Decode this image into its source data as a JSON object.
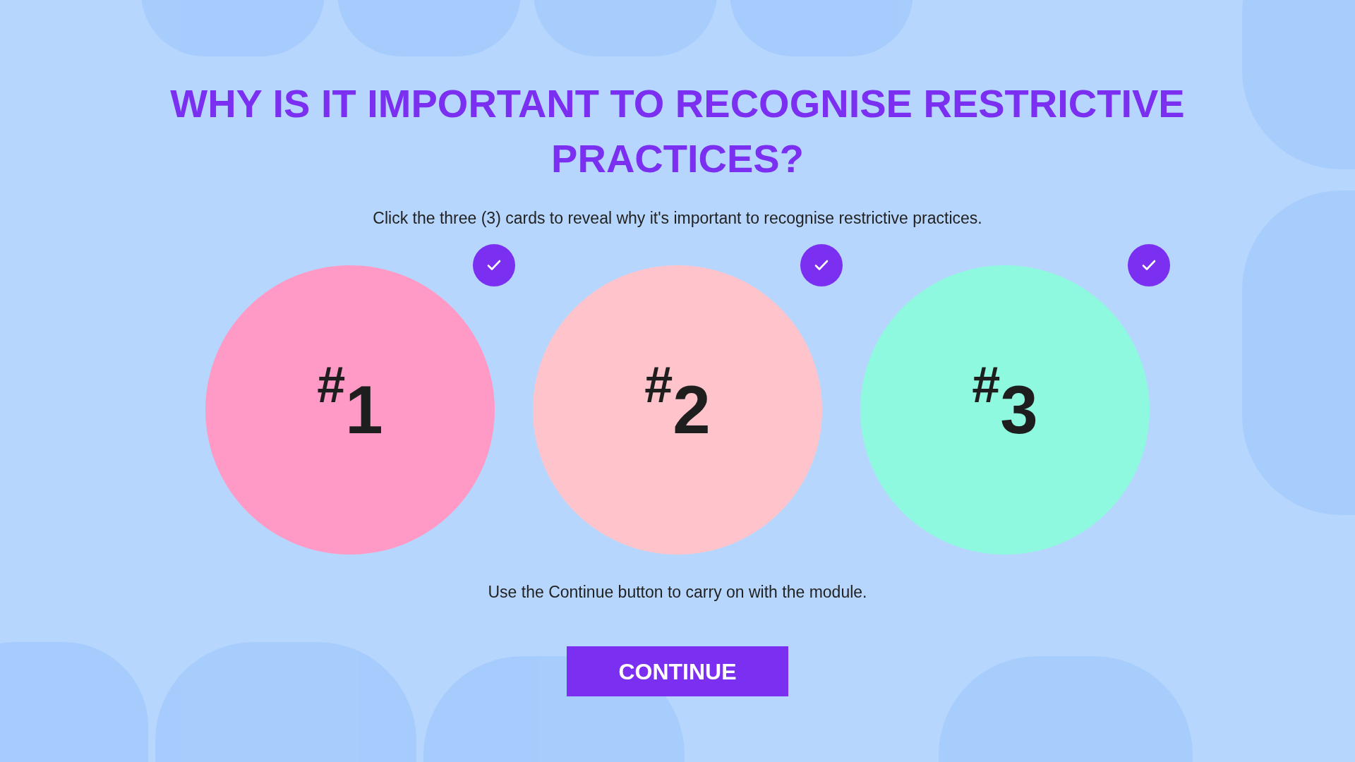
{
  "title": "WHY IS IT IMPORTANT TO RECOGNISE RESTRICTIVE PRACTICES?",
  "instruction": "Click the three (3) cards to reveal why it's important to recognise restrictive practices.",
  "cards": [
    {
      "label": "$^{#}$1",
      "color": "#ff9ac6",
      "checked": true
    },
    {
      "label": "$^{#}$2",
      "color": "#ffc4cb",
      "checked": true
    },
    {
      "label": "$^{#}$3",
      "color": "#8ef9de",
      "checked": true
    }
  ],
  "footer": "Use the Continue button to carry on with the module.",
  "button": "CONTINUE"
}
